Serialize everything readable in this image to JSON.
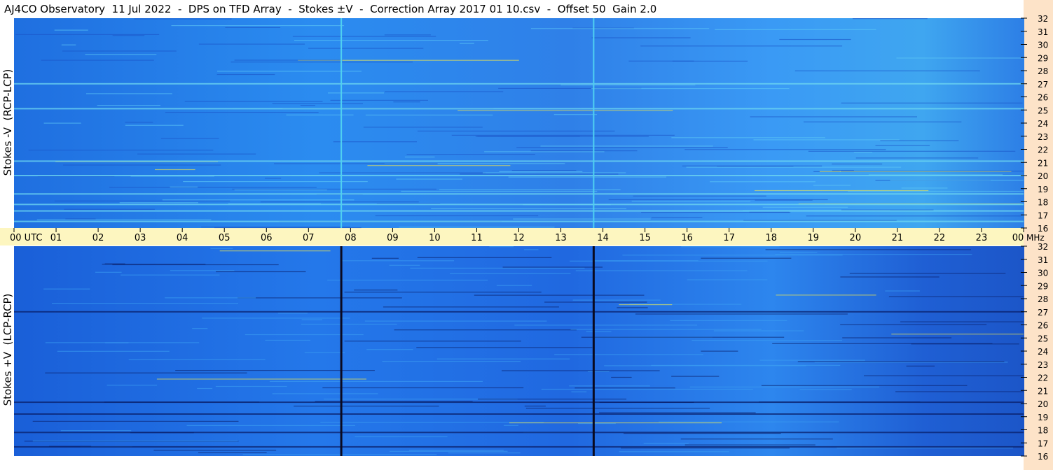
{
  "title": "AJ4CO Observatory  11 Jul 2022  -  DPS on TFD Array  -  Stokes ±V  -  Correction Array 2017 01 10.csv  -  Offset 50  Gain 2.0",
  "colors": {
    "time_band": "#fdf6c0",
    "right_strip": "#fde3c8",
    "spectrogram_base": "#2b7fe8",
    "spectrogram_dark": "#0a1f6a",
    "spectrogram_hot": "#f5e94a",
    "marker_line_top": "#4fd0f0",
    "marker_line_bottom": "#0a0a20"
  },
  "chart_data": [
    {
      "type": "heatmap",
      "ylabel": "Stokes -V  (RCP-LCP)",
      "xlabel": "",
      "y_unit": "MHz",
      "ylim": [
        16,
        32
      ],
      "y_ticks": [
        "16",
        "17",
        "18",
        "19",
        "20",
        "21",
        "22",
        "23",
        "24",
        "25",
        "26",
        "27",
        "28",
        "29",
        "30",
        "31",
        "32"
      ],
      "x_unit": "UTC",
      "xlim": [
        0,
        24
      ],
      "x_ticks": [
        "00 UTC",
        "01",
        "02",
        "03",
        "04",
        "05",
        "06",
        "07",
        "08",
        "09",
        "10",
        "11",
        "12",
        "13",
        "14",
        "15",
        "16",
        "17",
        "18",
        "19",
        "20",
        "21",
        "22",
        "23",
        "00"
      ],
      "marker_lines_utc": [
        7.78,
        13.78
      ],
      "bright_bands_mhz": [
        16.5,
        17.3,
        17.8,
        18.6,
        20.0,
        21.1,
        25.1,
        27.0
      ]
    },
    {
      "type": "heatmap",
      "ylabel": "Stokes +V  (LCP-RCP)",
      "xlabel": "",
      "y_unit": "MHz",
      "ylim": [
        16,
        32
      ],
      "y_ticks": [
        "16",
        "17",
        "18",
        "19",
        "20",
        "21",
        "22",
        "23",
        "24",
        "25",
        "26",
        "27",
        "28",
        "29",
        "30",
        "31",
        "32"
      ],
      "x_unit": "UTC",
      "xlim": [
        0,
        24
      ],
      "marker_lines_utc": [
        7.78,
        13.78
      ],
      "dark_bands_mhz": [
        16.7,
        17.8,
        19.2,
        20.1,
        27.0
      ]
    }
  ],
  "axis": {
    "x_unit_suffix": "MHz"
  }
}
